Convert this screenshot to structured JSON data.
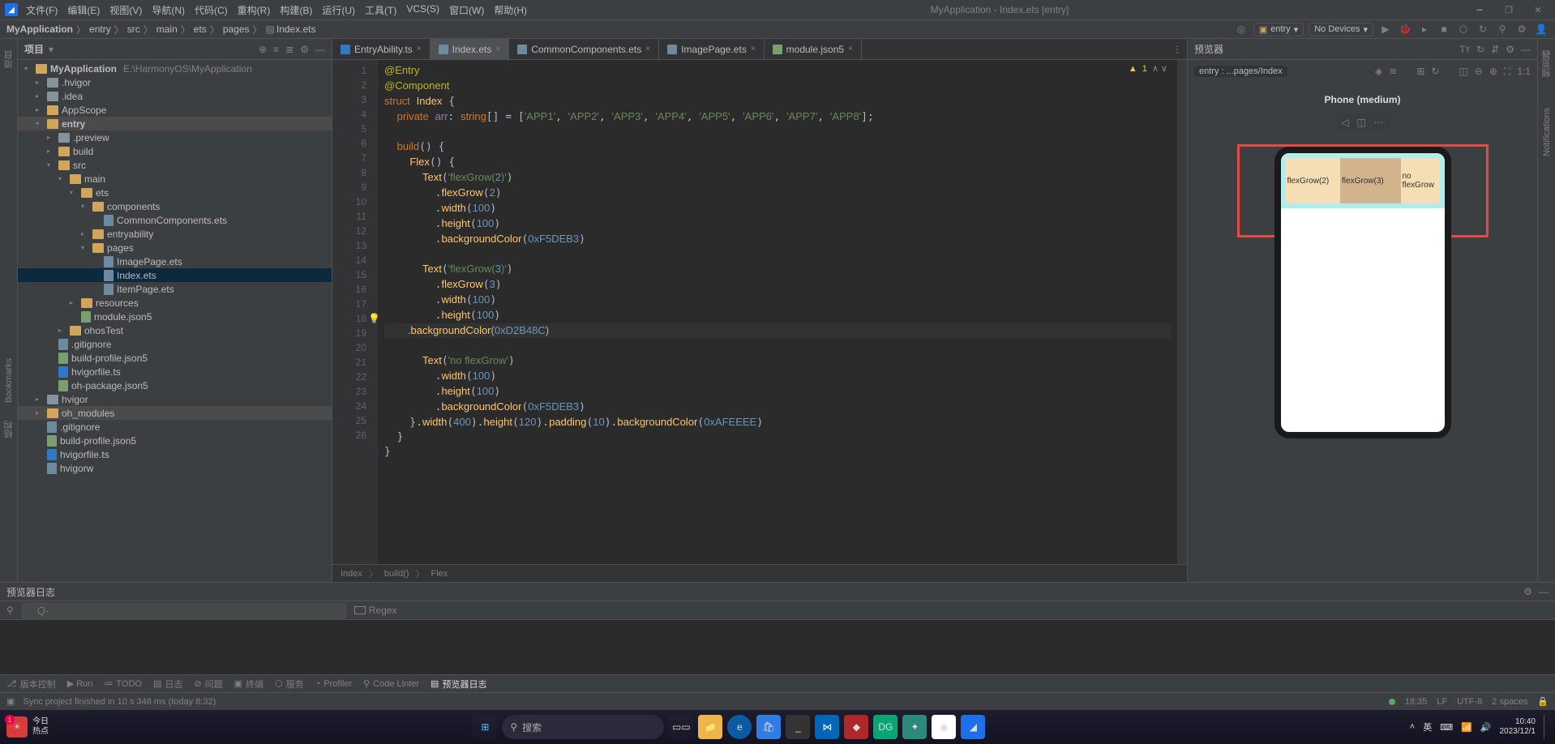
{
  "title_center": "MyApplication - Index.ets [entry]",
  "menus": [
    "文件(F)",
    "编辑(E)",
    "视图(V)",
    "导航(N)",
    "代码(C)",
    "重构(R)",
    "构建(B)",
    "运行(U)",
    "工具(T)",
    "VCS(S)",
    "窗口(W)",
    "帮助(H)"
  ],
  "breadcrumbs": [
    "MyApplication",
    "entry",
    "src",
    "main",
    "ets",
    "pages",
    "Index.ets"
  ],
  "nav_entry": "entry",
  "nav_devices": "No Devices",
  "left_tabs": {
    "project": "项目",
    "structure": "结构",
    "bookmarks": "Bookmarks"
  },
  "right_tabs": {
    "previewer": "预览器",
    "notifications": "Notifications"
  },
  "project_panel_title": "项目",
  "tree": {
    "root": {
      "name": "MyApplication",
      "path": "E:\\HarmonyOS\\MyApplication"
    },
    "hvigor": ".hvigor",
    "idea": ".idea",
    "appscope": "AppScope",
    "entry": "entry",
    "preview": ".preview",
    "build": "build",
    "src": "src",
    "main": "main",
    "ets": "ets",
    "components": "components",
    "common_components": "CommonComponents.ets",
    "entryability": "entryability",
    "pages": "pages",
    "image_page": "ImagePage.ets",
    "index": "Index.ets",
    "item_page": "ItemPage.ets",
    "resources": "resources",
    "module_json": "module.json5",
    "ohosTest": "ohosTest",
    "gitignore": ".gitignore",
    "build_profile": "build-profile.json5",
    "hvigorfile": "hvigorfile.ts",
    "oh_package": "oh-package.json5",
    "hvigor2": "hvigor",
    "oh_modules": "oh_modules",
    "gitignore2": ".gitignore",
    "build_profile2": "build-profile.json5",
    "hvigorfile2": "hvigorfile.ts",
    "hvigorw": "hvigorw"
  },
  "editor_tabs": [
    {
      "name": "EntryAbility.ts",
      "icon": "ts"
    },
    {
      "name": "Index.ets",
      "icon": "ets",
      "active": true
    },
    {
      "name": "CommonComponents.ets",
      "icon": "ets"
    },
    {
      "name": "ImagePage.ets",
      "icon": "ets"
    },
    {
      "name": "module.json5",
      "icon": "json"
    }
  ],
  "analysis": {
    "warn": "1",
    "err": "^"
  },
  "code_lines": [
    "@Entry",
    "@Component",
    "struct Index {",
    "  private arr: string[] = ['APP1', 'APP2', 'APP3', 'APP4', 'APP5', 'APP6', 'APP7', 'APP8'];",
    "",
    "  build() {",
    "    Flex() {",
    "      Text('flexGrow(2)')",
    "        .flexGrow(2)",
    "        .width(100)",
    "        .height(100)",
    "        .backgroundColor(0xF5DEB3)",
    "",
    "      Text('flexGrow(3)')",
    "        .flexGrow(3)",
    "        .width(100)",
    "        .height(100)",
    "        .backgroundColor(0xD2B48C)",
    "",
    "      Text('no flexGrow')",
    "        .width(100)",
    "        .height(100)",
    "        .backgroundColor(0xF5DEB3)",
    "    }.width(400).height(120).padding(10).backgroundColor(0xAFEEEE)",
    "  }",
    "}"
  ],
  "line_start": 1,
  "highlighted_line": 18,
  "editor_breadcrumbs": [
    "Index",
    "build()",
    "Flex"
  ],
  "preview_panel_title": "预览器",
  "preview_path": "entry : ...pages/Index",
  "device_label": "Phone (medium)",
  "flex_labels": {
    "c1": "flexGrow(2)",
    "c2": "flexGrow(3)",
    "c3": "no flexGrow"
  },
  "log_panel_title": "预览器日志",
  "filter_placeholder": "Q-",
  "regex_label": "Regex",
  "bottom_tools": [
    "版本控制",
    "▶ Run",
    "TODO",
    "日志",
    "问题",
    "终端",
    "服务",
    "Profiler",
    "Code Linter",
    "预览器日志"
  ],
  "status": {
    "msg": "Sync project finished in 10 s 348 ms (today 8:32)",
    "time": "18:35",
    "lf": "LF",
    "enc": "UTF-8",
    "spaces": "2 spaces"
  },
  "taskbar": {
    "weather_top": "今日",
    "weather_bottom": "热点",
    "search": "搜索",
    "tray": {
      "lang": "英",
      "ime": "⌨",
      "time": "10:40",
      "date": "2023/12/1"
    }
  }
}
